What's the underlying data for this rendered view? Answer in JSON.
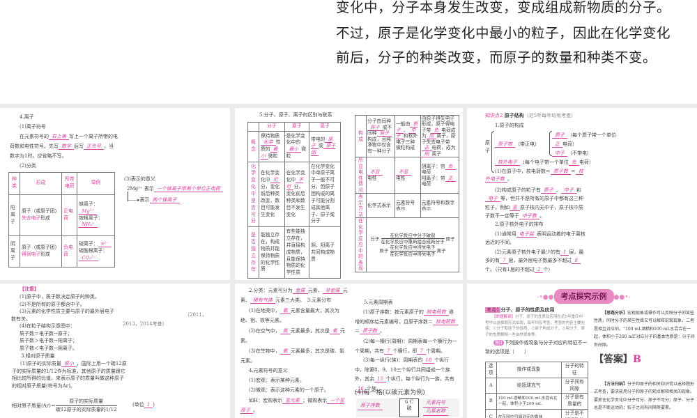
{
  "top_text": [
    "变化中，分子本身发生改变，变成组成新物质的分子。",
    "不过，原子是化学变化中最小的粒子，因此在化学变化",
    "前后，分子的种类改变，而原子的数量和种类不变。"
  ],
  "p1": {
    "title": "4.离子",
    "s1": "(1)离子符号",
    "l1a": "在元素符号的",
    "a1": "右上角",
    "l1b": "写上一个离子所带的电",
    "l2a": "荷数和电性符号。先写",
    "a2": "数字",
    "l2b": "后写",
    "a3": "正负号",
    "l2c": "，当",
    "l3": "数字为1时，应省略不写。",
    "s2": "(2)分类",
    "headers": [
      "种类",
      "形成",
      "所带电荷",
      "举例"
    ],
    "rows": [
      {
        "kind": "阳离子",
        "form_a": "原子（或原子团）",
        "form_ans": "失去电子",
        "form_b": "形成",
        "charge": "正电荷",
        "ex1": "镁离子：",
        "ex1a": "Mg²⁺",
        "ex2": "铵根离子：",
        "ex2a": "NH₄⁺"
      },
      {
        "kind": "阴离子",
        "form_a": "原子（或原子团）",
        "form_ans": "得到电子",
        "form_b": "形成",
        "charge": "负电荷",
        "ex1": "硫离子：",
        "ex1a": "S²⁻",
        "ex2": "碳酸根离子：",
        "ex2a": "CO₃²⁻"
      }
    ],
    "s3": "(3)表示的意义",
    "sym": "2Mg²⁺",
    "means": "表示",
    "m1": "一个镁离子带两个单位正电荷",
    "m2": "两个镁离子"
  },
  "p2": {
    "title": "5.分子、原子、离子的区别与联系",
    "headers": [
      "",
      "分子",
      "原子",
      "离子"
    ],
    "rows": [
      {
        "h": "概念",
        "c1": "保持物质",
        "c1a": "化学",
        "c1b": "性质的",
        "c1c": "最小",
        "c1d": "微粒",
        "c2": "是化学变化中的",
        "c2a": "最小",
        "c2b": "微粒",
        "c3": "带电的",
        "c3a": "原子",
        "c3b": "或",
        "c3c": "原子团"
      },
      {
        "h": "化学变化中是否可分",
        "c1": "在化学变化中",
        "c1a": "可",
        "c1b": "分，变化前后种类改变、数目可能发生变化",
        "c2": "在化学变化中",
        "c2a": "不可",
        "c2b": "分，变化前后种类和数目不发生变化",
        "c3": "在化学变化中单原子离子一般不可分，但原子团构成的离子可能分割成其他离子、原子或分子"
      },
      {
        "h": "是否独立存在",
        "c1": "能独立存在，构成物质并能保持物质的化学性质",
        "c2": "有些能独立存在，并直接构成物质，且能保持物质的化学性质",
        "c3": "阴、阳离子共同构成物质"
      }
    ],
    "rows2": [
      {
        "h": "构成",
        "c1": "分子由同种",
        "c1a": "原子",
        "c1b": "或不同种",
        "c1c": "原子",
        "c1d": "构成，且纯净物中仅含有一种分子",
        "c2": "一般由",
        "c2a": "质子",
        "c2b": "、",
        "c2c": "中子",
        "c2d": "和核外电子三种微粒构成",
        "c3": "由原子得失电子形成，原子得电子带",
        "c3a": "负",
        "c3b": "电荷成为",
        "c3c": "阴",
        "c3d": "离子，原子失去电子带",
        "c3e": "正",
        "c3f": "电荷，成为",
        "c3g": "阳",
        "c3h": "离子"
      },
      {
        "h": "所显电性情况",
        "c1a": "不显",
        "c1": "电性",
        "c2a": "不显",
        "c2": "电性",
        "c3": "阴离子：带",
        "c3a": "负",
        "c3b": "电荷",
        "c3c": "阳离子：带",
        "c3d": "正",
        "c3e": "电荷"
      },
      {
        "h": "表示方法",
        "c1": "化学式表示",
        "c2": "元素符号表示",
        "c3": "元素符号和数字表示"
      },
      {
        "h": "在化学反应中的表现",
        "f1l": "分子",
        "f1t": "在化学反应中分子破裂",
        "f1b": "在化学反应中重新组合成新分子",
        "f1r": "原子",
        "f2l": "原子",
        "f2t": "在化学反应中得失电子",
        "f2b": "在化学反应中得失电子",
        "f2r": "离子"
      }
    ]
  },
  "p3": {
    "tag": "知识点2",
    "title": "原子结构",
    "note": "（近5年每年均有考查）",
    "s1": "1.原子的构成",
    "atom": "原子",
    "nucleus": "原子核",
    "pos": "（带正电）",
    "proton": "质子",
    "proton_d": "（每个质子带一个单位",
    "pos2": "正",
    "charge": "电荷）",
    "neutron": "中子",
    "neutron_d": "（不带电）",
    "electron": "核外电子",
    "electron_d": "（每个电子带一个单位",
    "neg": "负",
    "charge2": "电荷）",
    "q1a": "(1)在原子中，核电荷数＝",
    "q1b": "质子数",
    "q1c": "＝",
    "q1d": "核外电子数",
    "q1e": "。",
    "q2a": "(2)构成原子的粒子有",
    "q2b": "质子",
    "q2c": "、",
    "q2d": "中子",
    "q2e": "和",
    "q2f": "电子",
    "q2g": "等，但并不是所有的原子中都有这三种粒子，例如",
    "q2h": "氢",
    "q2i": "原子核内无中子，原子核中质子数不一定等于",
    "q2j": "中子数",
    "q2k": "。",
    "s2": "2.原子核外电子的排布",
    "q3a": "(1)通常用",
    "q3b": "电子层",
    "q3c": "表明运动着的电子离核远近的不同。",
    "q4a": "(2)元素原子核外电子最少的有",
    "q4b": "1",
    "q4c": "层，最多的有",
    "q4d": "7",
    "q4e": "层，最外层电子数最多不超过",
    "q4f": "8",
    "q4g": "个。",
    "q4h": "（只有1层的不超过",
    "q4i": "2",
    "q4j": "个）"
  },
  "p4": {
    "note": "【注意】",
    "items": [
      "(1)原子中，质子数决定原子的种类。",
      "(2)不是所有的原子都含中子。",
      "(3)元素的化学性质主要与原子的最外层电子",
      "数有关。",
      "(4)在粒子结构示意图中：",
      "质子数＝电子数→原子；",
      "质子数＞电子数→阳离子；",
      "质子数＜电子数→阴离子。"
    ],
    "side": "（2011，",
    "side2": "2013，2014考查）",
    "s3": "3.相对原子质量",
    "r1a": "(1)原子的实际质量",
    "r1b": "很小",
    "r1c": "，国际上用一个碳12原子的实际质量的1/12作为标准，其他原子的质量跟它相比较所得的比值，来表示原子的质量叫做这种原子的相对原子质量(符号为Ar)。",
    "f_l": "相对原子质量(Ar)＝",
    "f_n": "原子的实际质量",
    "f_d": "碳12原子的实际质量的1/12",
    "unit": "(单位",
    "unit_a": "1",
    "unit_b": ")"
  },
  "p5": {
    "c1a": "2.分类：元素可分为",
    "c1b": "金属",
    "c1c": "元素、",
    "c1d": "非金属",
    "c1e": "元素、",
    "c1f": "稀有气体",
    "c1g": "元素三大类。",
    "c1h": "3.元素分布",
    "d1a": "(1)在地壳中，",
    "d1b": "氧",
    "d1c": "元素含量最大，其次为硅、铝、铁等元素。",
    "d2a": "(2)在空气中，",
    "d2b": "氮",
    "d2c": "元素最多，其次是",
    "d2d": "氧",
    "d2e": "元素。",
    "d3a": "(3)在生物中，",
    "d3b": "氧",
    "d3c": "元素最多，其次是碳、氢元素。",
    "s4": "4.元素符号的意义",
    "e1": "(1)宏观：表示某种元素。",
    "e2": "(2)微观：表示这种元素的一个原子。",
    "e3a": "如H：宏观表示",
    "e3b": "氢元素",
    "e3c": "；微观表示",
    "e3d": "一个氢原子",
    "e3e": "。",
    "s5": "5.元素周期表",
    "t1a": "(1)原子序数：按元素原子的",
    "t1b": "核电荷数",
    "t1c": "递增的顺序给元素编号，且原子序数＝",
    "t1d": "核电荷数",
    "t1e": "＝",
    "t1f": "质子数",
    "t1g": "。",
    "t2a": "(2)每一横行(周期)：周期表每一个横行为一个周期，共有",
    "t2b": "7",
    "t2c": "个横行，即",
    "t2d": "7",
    "t2e": "个周期。",
    "t3a": "(3)每一纵行(族)：周期表的",
    "t3b": "18",
    "t3c": "个纵行中，除第8、9、10三个纵行共同组成一个族外，其余",
    "t3d": "15",
    "t3e": "个纵行，每个纵行为一族，共有",
    "t3f": "16",
    "t3g": "个族。",
    "s6": "(4)每一格(以碳元素为例)",
    "cell": "6 C",
    "cell2": "碳",
    "lab1": "原子序数",
    "lab2": "元素符号",
    "lab3": "元素名称"
  },
  "p6": {
    "banner": "考点探究示例",
    "tag": "考点1",
    "title": "分子、原子的性质及应用",
    "expl_tag": "【命题解读】",
    "expl": "分子、原子的性质及应用在近5年重庆中考中以选择题形式出现，每年均有考查，考查的内容主要包括：①分子和原子的性质，②原子构成分子，③用分子、原子的性质解释一些自然现象等。",
    "ex_tag": "例1",
    "ex": "下列操作或现象与分子对应的特征不一致的选项是",
    "paren": "（　　）",
    "headers": [
      "选项",
      "操作或现象",
      "分子的特征"
    ],
    "rows": [
      [
        "A",
        "给篮球充气",
        "分子间有间隙"
      ],
      [
        "B",
        "100 mL酒精和100 mL水混合在一起，体积小于200 mL",
        "分子是有质量的"
      ],
      [
        "C",
        "在花园中可闻到花的香味",
        "分子是不断运动的"
      ]
    ],
    "an_tag": "【思路分析】",
    "an": "宏观现象或操作可以反映分子的某些性质，同时分子的某些性质又可以解释宏观现象，二者是相互对应的。“100 mL酒精和100 mL水混合在一起，体积小于200 mL”对应分子的基本性质是：分子间有间隙。",
    "answer_label": "【答案】",
    "answer": "B",
    "m_tag": "【方法归纳】",
    "m": "分子和原子的相关知识常以选择题形式考查，要求能用分子和原子的观点解释相关的现象。要抓住化学变化中分子可分、原子不可分；原子、分子总是不断运动的；粒子之间有间隔等要素。"
  }
}
